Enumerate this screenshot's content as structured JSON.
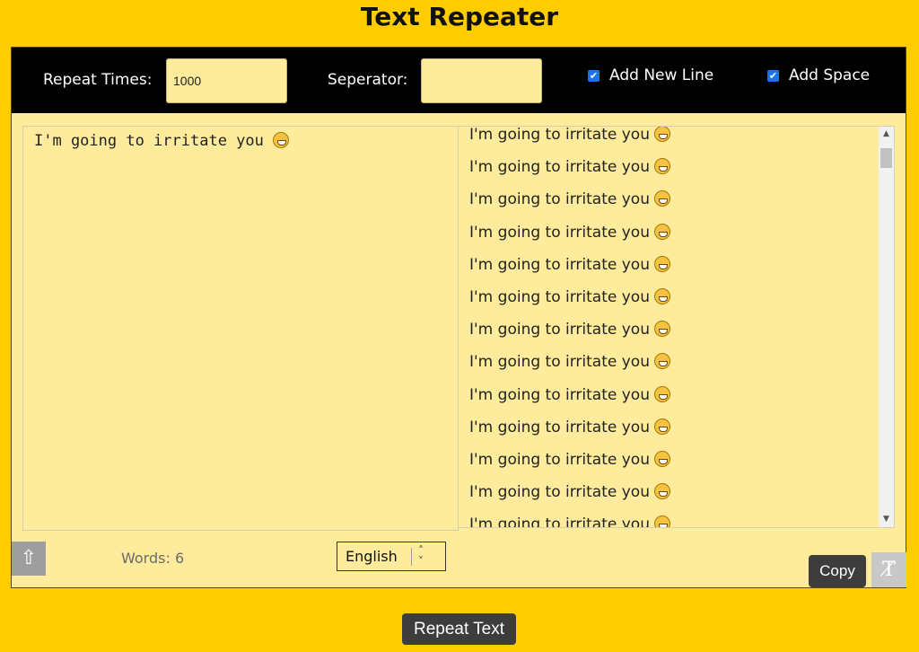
{
  "title": "Text Repeater",
  "toolbar": {
    "repeat_label": "Repeat Times:",
    "repeat_value": "1000",
    "separator_label": "Seperator:",
    "separator_value": "",
    "new_line_label": "Add New Line",
    "new_line_checked": true,
    "space_label": "Add Space",
    "space_checked": true
  },
  "input": {
    "text": "I'm going to irritate you",
    "emoji": "grinning-face-with-teeth"
  },
  "output": {
    "line_text": "I'm going to irritate you",
    "visible_lines": 13,
    "scroll_fraction": 0.02
  },
  "footer": {
    "words_label": "Words: 6",
    "language": "English",
    "copy_label": "Copy",
    "repeat_button": "Repeat Text"
  },
  "colors": {
    "page_bg": "#ffcc00",
    "panel_bg": "#ffeb9c",
    "toolbar_bg": "#000000",
    "button_bg": "#3d3d3d",
    "checkbox": "#1a73e8"
  }
}
